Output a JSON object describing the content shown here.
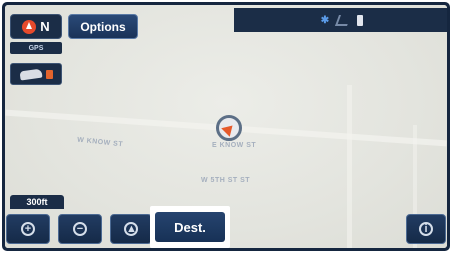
{
  "heading": {
    "label": "N"
  },
  "toolbar": {
    "options_label": "Options"
  },
  "gps_badge": "GPS",
  "scale": "300ft",
  "map": {
    "streets": [
      "W KNOW ST",
      "E KNOW ST",
      "W 5TH ST ST",
      "",
      ""
    ]
  },
  "bottom": {
    "dest_label": "Dest.",
    "zoom_in_glyph": "+",
    "zoom_out_glyph": "−",
    "info_glyph": "i"
  },
  "icons": [
    "compass-icon",
    "car-icon",
    "destination-flag-icon",
    "bluetooth-icon",
    "signal-icon",
    "battery-icon",
    "zoom-in-icon",
    "zoom-out-icon",
    "navigation-icon",
    "info-icon",
    "current-position-icon"
  ],
  "colors": {
    "panel": "#1b2d47",
    "accent_orange": "#e65a2c",
    "map_bg": "#e6e7e1"
  }
}
